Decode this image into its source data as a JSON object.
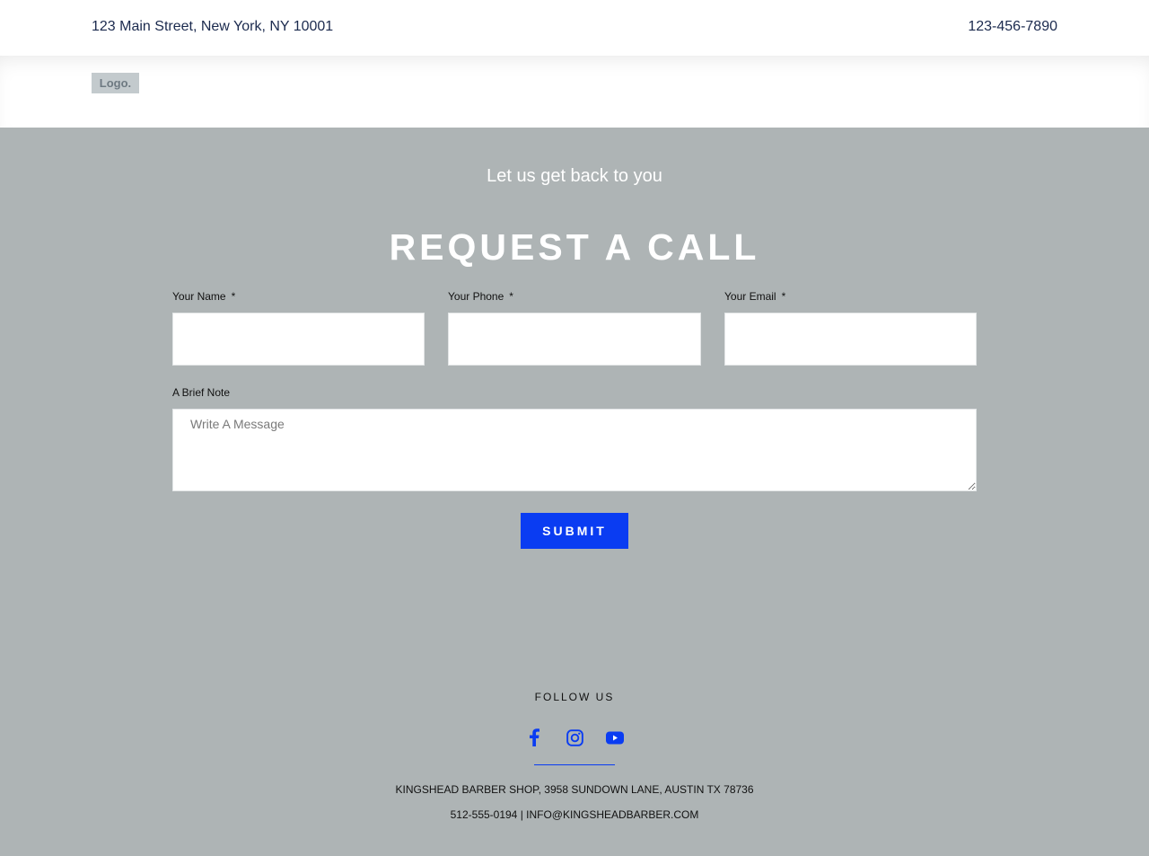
{
  "topbar": {
    "address": "123 Main Street, New York, NY 10001",
    "phone": "123-456-7890"
  },
  "header": {
    "logo": "Logo."
  },
  "section": {
    "subtitle": "Let us get back to you",
    "title": "REQUEST A CALL"
  },
  "form": {
    "name_label": "Your Name",
    "phone_label": "Your Phone",
    "email_label": "Your Email",
    "required_marker": "*",
    "name_value": "",
    "phone_value": "",
    "email_value": "",
    "note_label": "A Brief Note",
    "note_placeholder": "Write A Message",
    "submit_label": "SUBMIT"
  },
  "footer": {
    "follow_label": "FOLLOW US",
    "socials": [
      "facebook-icon",
      "instagram-icon",
      "youtube-icon"
    ],
    "address_line": "KINGSHEAD BARBER SHOP, 3958 SUNDOWN LANE, AUSTIN TX 78736",
    "contact_line": "512-555-0194 | INFO@KINGSHEADBARBER.COM"
  },
  "colors": {
    "accent": "#0a3cf2",
    "section_bg": "#aeb4b5",
    "header_text": "#1b2a4e"
  }
}
